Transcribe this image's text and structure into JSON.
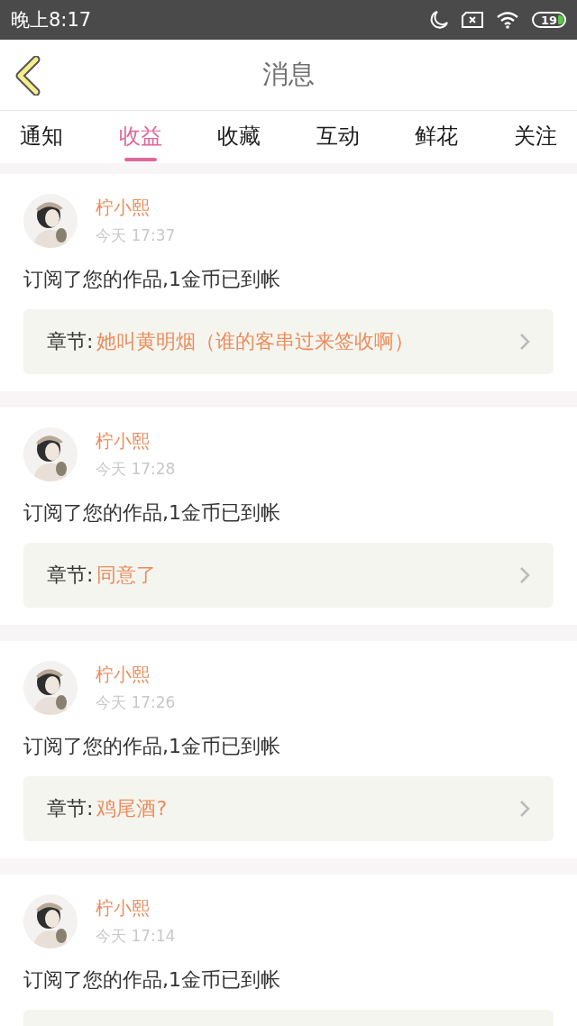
{
  "status_bar": {
    "time": "晚上8:17",
    "battery": "19"
  },
  "header": {
    "title": "消息"
  },
  "tabs": [
    {
      "label": "通知",
      "selected": false
    },
    {
      "label": "收益",
      "selected": true
    },
    {
      "label": "收藏",
      "selected": false
    },
    {
      "label": "互动",
      "selected": false
    },
    {
      "label": "鲜花",
      "selected": false
    },
    {
      "label": "关注",
      "selected": false
    }
  ],
  "messages": [
    {
      "user": "柠小熙",
      "time": "今天 17:37",
      "text": "订阅了您的作品,1金币已到帐",
      "chapter_label": "章节:",
      "chapter": "她叫黄明烟（谁的客串过来签收啊）"
    },
    {
      "user": "柠小熙",
      "time": "今天 17:28",
      "text": "订阅了您的作品,1金币已到帐",
      "chapter_label": "章节:",
      "chapter": "同意了"
    },
    {
      "user": "柠小熙",
      "time": "今天 17:26",
      "text": "订阅了您的作品,1金币已到帐",
      "chapter_label": "章节:",
      "chapter": "鸡尾酒?"
    },
    {
      "user": "柠小熙",
      "time": "今天 17:14",
      "text": "订阅了您的作品,1金币已到帐"
    }
  ]
}
